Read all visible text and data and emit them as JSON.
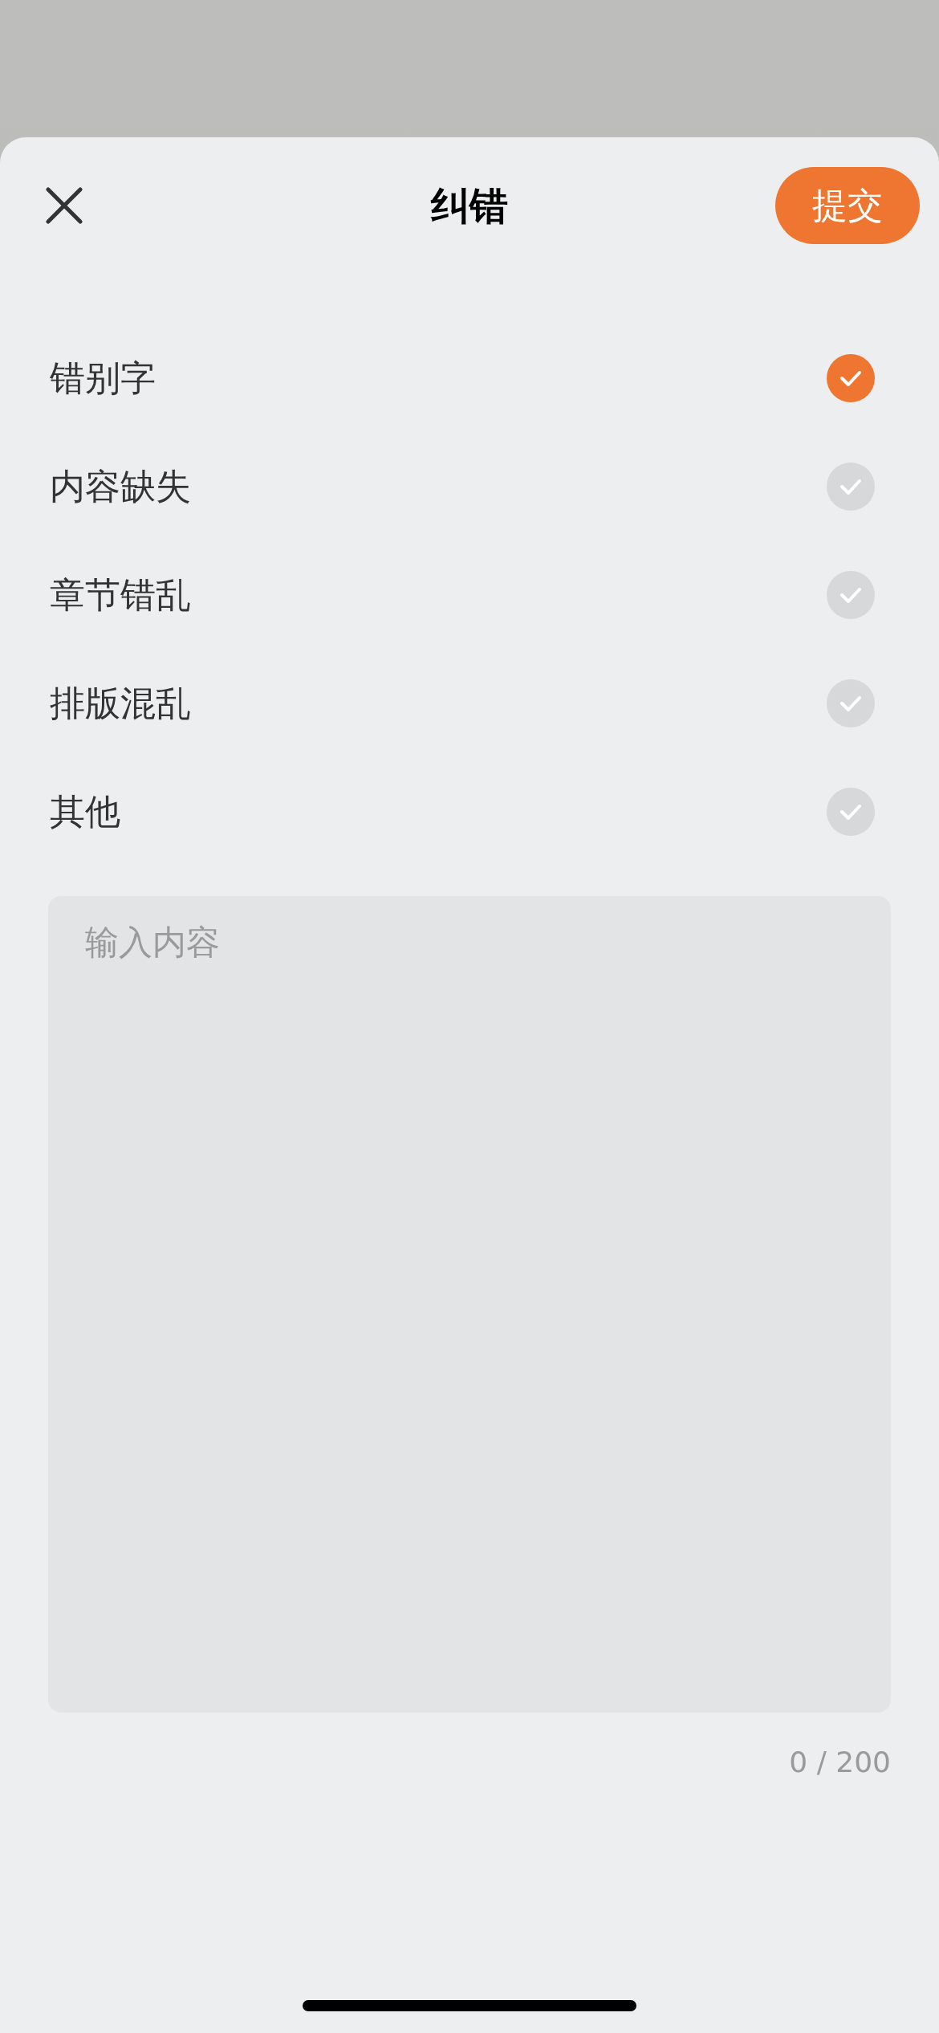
{
  "sheet": {
    "title": "纠错",
    "submit": "提交"
  },
  "options": [
    {
      "label": "错别字",
      "selected": true
    },
    {
      "label": "内容缺失",
      "selected": false
    },
    {
      "label": "章节错乱",
      "selected": false
    },
    {
      "label": "排版混乱",
      "selected": false
    },
    {
      "label": "其他",
      "selected": false
    }
  ],
  "input": {
    "placeholder": "输入内容",
    "counter": "0 / 200"
  }
}
